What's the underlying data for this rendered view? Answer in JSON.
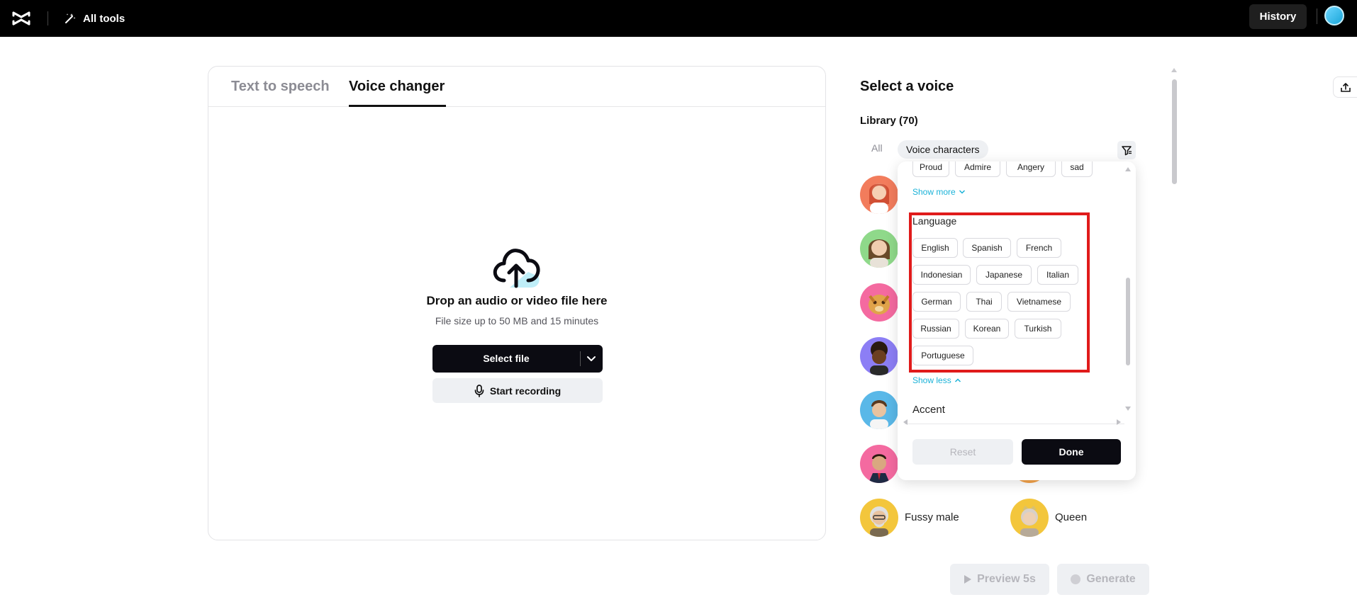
{
  "topbar": {
    "all_tools": "All tools",
    "history": "History"
  },
  "tabs": [
    {
      "label": "Text to speech",
      "active": false
    },
    {
      "label": "Voice changer",
      "active": true
    }
  ],
  "upload": {
    "title": "Drop an audio or video file here",
    "subtitle": "File size up to 50 MB and 15 minutes",
    "select_file": "Select file",
    "start_recording": "Start recording"
  },
  "voice_panel": {
    "title": "Select a voice",
    "library": "Library (70)",
    "chip_all": "All",
    "chip_voice_characters": "Voice characters",
    "voices": [
      {
        "name": "Fussy male",
        "color": "#f3c63c"
      },
      {
        "name": "Queen",
        "color": "#f3c63c"
      }
    ]
  },
  "filter": {
    "emotion_chips": [
      "Proud",
      "Admire",
      "Angery",
      "sad"
    ],
    "show_more": "Show more",
    "language_title": "Language",
    "languages": [
      "English",
      "Spanish",
      "French",
      "Indonesian",
      "Japanese",
      "Italian",
      "German",
      "Thai",
      "Vietnamese",
      "Russian",
      "Korean",
      "Turkish",
      "Portuguese"
    ],
    "show_less": "Show less",
    "accent_title": "Accent",
    "reset": "Reset",
    "done": "Done"
  },
  "bottom": {
    "preview": "Preview 5s",
    "generate": "Generate"
  },
  "colors": {
    "accent_link": "#1ab2d8",
    "highlight": "#e01b1b",
    "primary_button": "#0b0b12"
  }
}
